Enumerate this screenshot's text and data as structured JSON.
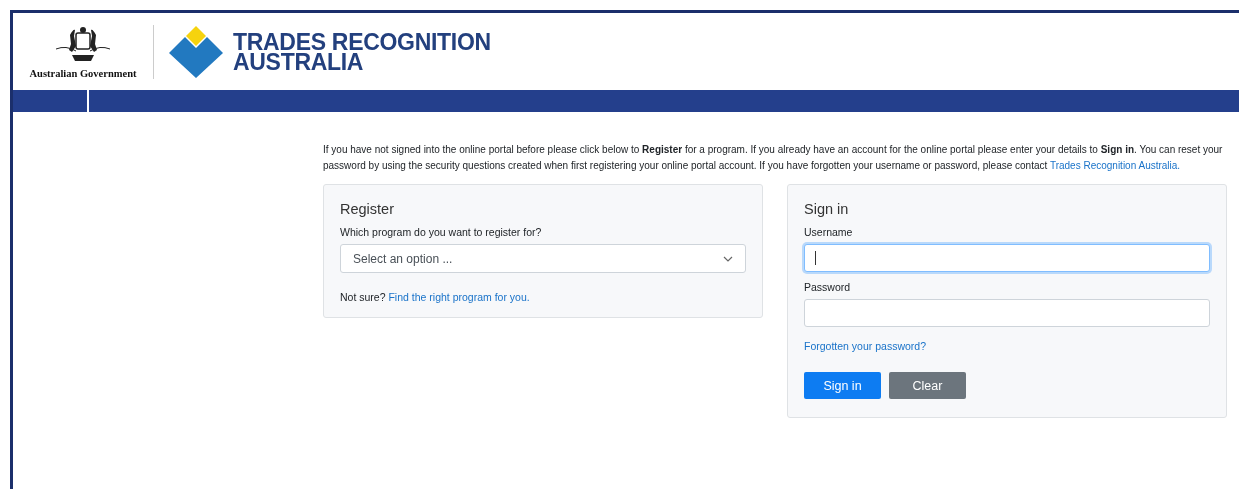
{
  "header": {
    "government_label": "Australian Government",
    "logo_text": [
      "TRADES RECOGNITION",
      "AUSTRALIA"
    ]
  },
  "intro": {
    "text": "If you have not signed into the online portal before please click below to **Register** for a program. If you already have an account for the online portal please enter your details to **Sign in**. You can reset your password by using the security questions created when first registering your online portal account. If you have forgotten your username or password, please contact ",
    "link": "Trades Recognition Australia."
  },
  "register": {
    "title": "Register",
    "question": "Which program do you want to register for?",
    "select": {
      "placeholder": "Select an option ..."
    },
    "hint": "Not sure?",
    "hint_link": "Find the right program for you."
  },
  "sign_in": {
    "title": "Sign in",
    "fields": [
      {
        "label": "Username",
        "focused": true
      },
      {
        "label": "Password",
        "focused": false
      }
    ],
    "forgot_link": "Forgotten your password?",
    "buttons": [
      {
        "label": "Sign in",
        "kind": "primary"
      },
      {
        "label": "Clear",
        "kind": "secondary"
      }
    ]
  }
}
